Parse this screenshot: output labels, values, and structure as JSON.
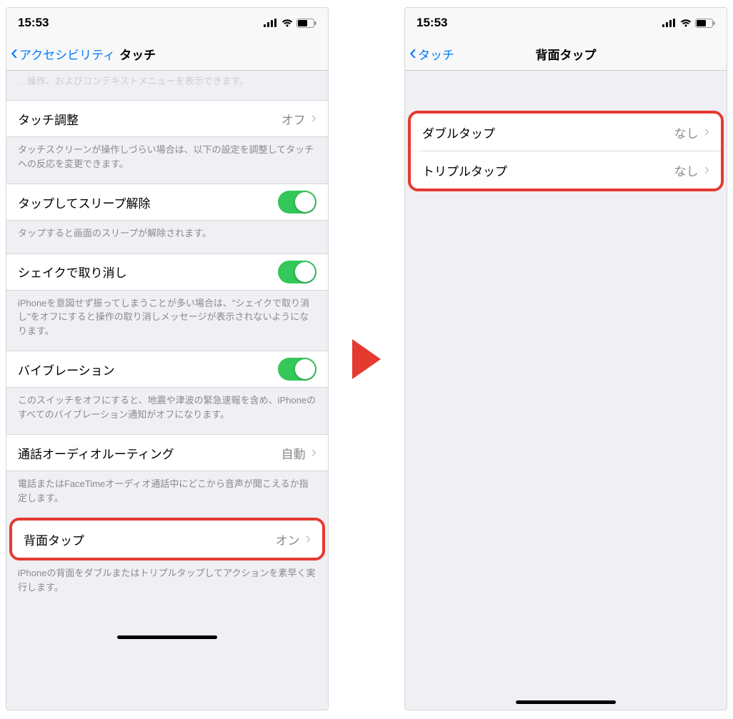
{
  "status": {
    "time": "15:53"
  },
  "left": {
    "back_label": "アクセシビリティ",
    "title": "タッチ",
    "cutoff_note": "…操作、およびコンテキストメニューを表示できます。",
    "rows": {
      "touch_accom": {
        "label": "タッチ調整",
        "value": "オフ"
      },
      "touch_accom_note": "タッチスクリーンが操作しづらい場合は、以下の設定を調整してタッチへの反応を変更できます。",
      "tap_wake": {
        "label": "タップしてスリープ解除"
      },
      "tap_wake_note": "タップすると画面のスリープが解除されます。",
      "shake": {
        "label": "シェイクで取り消し"
      },
      "shake_note": "iPhoneを意図せず振ってしまうことが多い場合は、\"シェイクで取り消し\"をオフにすると操作の取り消しメッセージが表示されないようになります。",
      "vibration": {
        "label": "バイブレーション"
      },
      "vibration_note": "このスイッチをオフにすると、地震や津波の緊急速報を含め、iPhoneのすべてのバイブレーション通知がオフになります。",
      "audio_route": {
        "label": "通話オーディオルーティング",
        "value": "自動"
      },
      "audio_route_note": "電話またはFaceTimeオーディオ通話中にどこから音声が聞こえるか指定します。",
      "back_tap": {
        "label": "背面タップ",
        "value": "オン"
      },
      "back_tap_note": "iPhoneの背面をダブルまたはトリプルタップしてアクションを素早く実行します。"
    }
  },
  "right": {
    "back_label": "タッチ",
    "title": "背面タップ",
    "double_tap": {
      "label": "ダブルタップ",
      "value": "なし"
    },
    "triple_tap": {
      "label": "トリプルタップ",
      "value": "なし"
    }
  }
}
